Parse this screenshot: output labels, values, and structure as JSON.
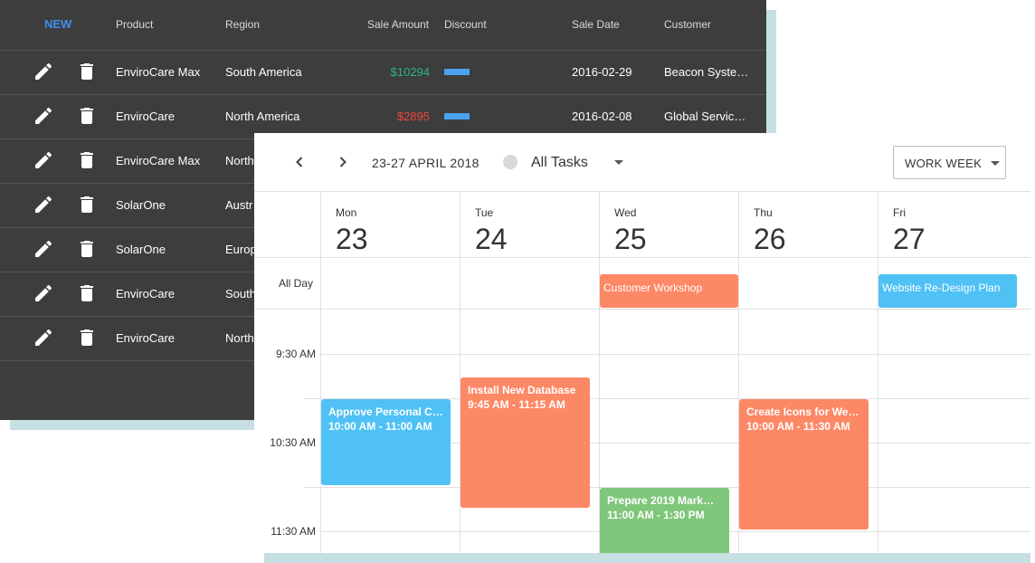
{
  "grid": {
    "new_label": "NEW",
    "columns": [
      "Product",
      "Region",
      "Sale Amount",
      "Discount",
      "Sale Date",
      "Customer"
    ],
    "rows": [
      {
        "product": "EnviroCare Max",
        "region": "South America",
        "amount": "$10294",
        "amount_color": "#2ab38a",
        "discount_fraction": 0.5,
        "date": "2016-02-29",
        "customer": "Beacon Syste…"
      },
      {
        "product": "EnviroCare",
        "region": "North America",
        "amount": "$2895",
        "amount_color": "#f0483c",
        "discount_fraction": 0.5,
        "date": "2016-02-08",
        "customer": "Global Servic…"
      },
      {
        "product": "EnviroCare Max",
        "region": "North",
        "amount": "",
        "amount_color": "#2ab38a",
        "discount_fraction": 0,
        "date": "",
        "customer": ""
      },
      {
        "product": "SolarOne",
        "region": "Austr",
        "amount": "",
        "amount_color": "#2ab38a",
        "discount_fraction": 0,
        "date": "",
        "customer": ""
      },
      {
        "product": "SolarOne",
        "region": "Europ",
        "amount": "",
        "amount_color": "#2ab38a",
        "discount_fraction": 0,
        "date": "",
        "customer": ""
      },
      {
        "product": "EnviroCare",
        "region": "South",
        "amount": "",
        "amount_color": "#2ab38a",
        "discount_fraction": 0,
        "date": "",
        "customer": ""
      },
      {
        "product": "EnviroCare",
        "region": "North",
        "amount": "",
        "amount_color": "#2ab38a",
        "discount_fraction": 0,
        "date": "",
        "customer": ""
      }
    ],
    "icons": {
      "edit": "pencil-icon",
      "delete": "trash-icon"
    }
  },
  "scheduler": {
    "range_label": "23-27 APRIL 2018",
    "task_filter": "All Tasks",
    "view": "WORK WEEK",
    "all_day_label": "All Day",
    "days": [
      {
        "name": "Mon",
        "num": "23"
      },
      {
        "name": "Tue",
        "num": "24"
      },
      {
        "name": "Wed",
        "num": "25"
      },
      {
        "name": "Thu",
        "num": "26"
      },
      {
        "name": "Fri",
        "num": "27"
      }
    ],
    "time_labels": [
      "9:30 AM",
      "10:30 AM",
      "11:30 AM"
    ],
    "all_day_events": [
      {
        "title": "Customer Workshop",
        "day": 2,
        "color": "#fd8866"
      },
      {
        "title": "Website Re-Design Plan",
        "day": 4,
        "color": "#4fc1f5"
      }
    ],
    "events": [
      {
        "title": "Approve Personal C…",
        "time": "10:00 AM - 11:00 AM",
        "day": 0,
        "color": "#4fc1f5"
      },
      {
        "title": "Install New Database",
        "time": "9:45 AM - 11:15 AM",
        "day": 1,
        "color": "#fd8866"
      },
      {
        "title": "Prepare 2019 Mark…",
        "time": "11:00 AM - 1:30 PM",
        "day": 2,
        "color": "#7fc77a"
      },
      {
        "title": "Create Icons for We…",
        "time": "10:00 AM - 11:30 AM",
        "day": 3,
        "color": "#fd8866"
      }
    ]
  }
}
